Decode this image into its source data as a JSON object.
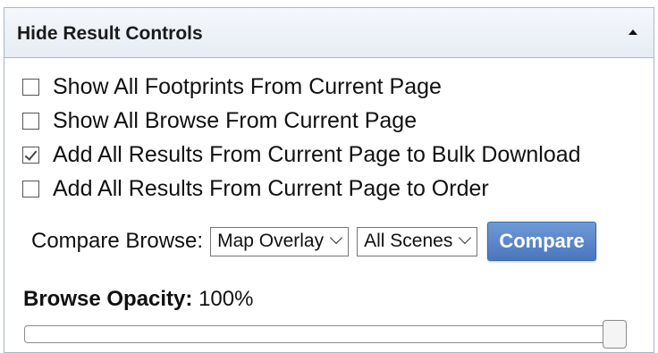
{
  "panel": {
    "title": "Hide Result Controls",
    "collapse_icon": "triangle-up-icon"
  },
  "options": [
    {
      "label": "Show All Footprints From Current Page",
      "checked": false
    },
    {
      "label": "Show All Browse From Current Page",
      "checked": false
    },
    {
      "label": "Add All Results From Current Page to Bulk Download",
      "checked": true
    },
    {
      "label": "Add All Results From Current Page to Order",
      "checked": false
    }
  ],
  "compare": {
    "label": "Compare Browse:",
    "mode_selected": "Map Overlay",
    "scope_selected": "All Scenes",
    "button_label": "Compare",
    "button_color": "#5a86cc"
  },
  "opacity": {
    "label": "Browse Opacity:",
    "value_text": "100%",
    "value": 1.0
  }
}
